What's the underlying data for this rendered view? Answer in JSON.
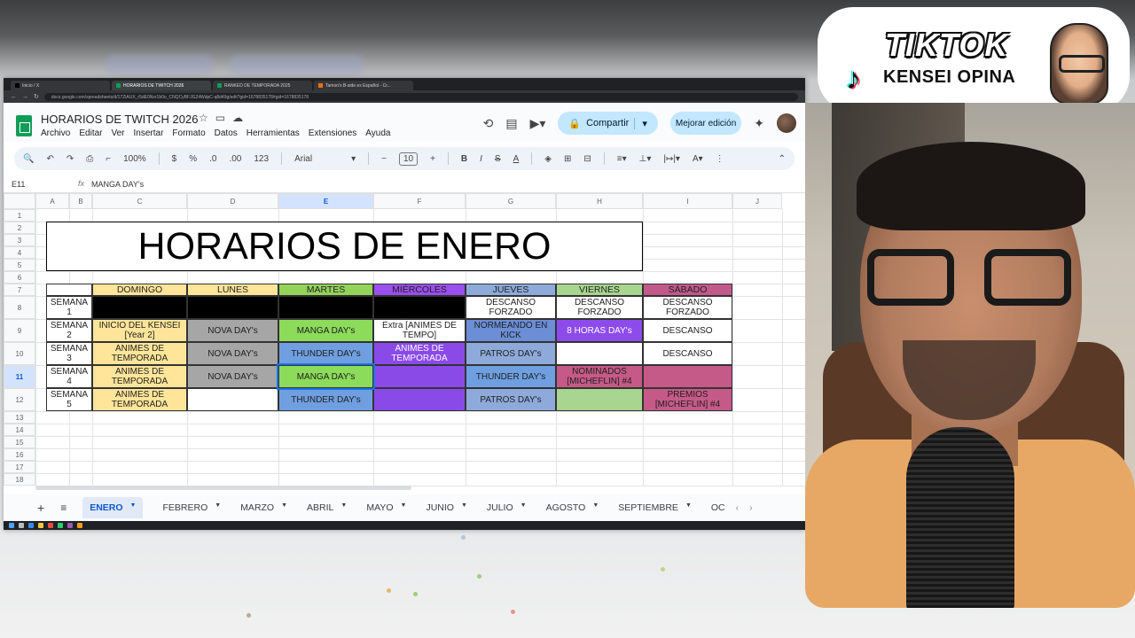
{
  "browser": {
    "tabs": [
      "Inicio / X",
      "HORARIOS DE TWITCH 2026",
      "RANKED DE TEMPORADA 2025",
      "Tamon's B-side es Español - Cr..."
    ],
    "url": "docs.google.com/spreadsheets/d/17ZiAUX_r5dE0Nxr1b0o_CNQCyBFJG24WdpC-q8d49g/edit?gid=1678835178#gid=1678835178"
  },
  "doc": {
    "title": "HORARIOS DE TWITCH 2026",
    "menu": [
      "Archivo",
      "Editar",
      "Ver",
      "Insertar",
      "Formato",
      "Datos",
      "Herramientas",
      "Extensiones",
      "Ayuda"
    ],
    "share_label": "Compartir",
    "improve_label": "Mejorar edición"
  },
  "toolbar": {
    "zoom": "100%",
    "currency": "$",
    "percent": "%",
    "dec_less": ".0",
    "dec_more": ".00",
    "number_format": "123",
    "font": "Arial",
    "font_size": "10",
    "bold": "B",
    "italic": "I",
    "strike": "S",
    "text_color": "A"
  },
  "formula_bar": {
    "cell_ref": "E11",
    "fx": "fx",
    "content": "MANGA DAY's"
  },
  "grid": {
    "columns": [
      "A",
      "B",
      "C",
      "D",
      "E",
      "F",
      "G",
      "H",
      "I",
      "J"
    ],
    "rows": [
      "1",
      "2",
      "3",
      "4",
      "5",
      "6",
      "7",
      "8",
      "9",
      "10",
      "11",
      "12",
      "13",
      "14",
      "15",
      "16",
      "17",
      "18"
    ],
    "title": "HORARIOS DE ENERO",
    "days": [
      "DOMINGO",
      "LUNES",
      "MARTES",
      "MIÉRCOLES",
      "JUEVES",
      "VIERNES",
      "SÁBADO"
    ],
    "weeks": [
      "SEMANA 1",
      "SEMANA 2",
      "SEMANA 3",
      "SEMANA 4",
      "SEMANA 5"
    ],
    "schedule": [
      [
        "",
        "",
        "",
        "",
        "DESCANSO FORZADO",
        "DESCANSO FORZADO",
        "DESCANSO FORZADO"
      ],
      [
        "INICIO DEL KENSEI [Year 2]",
        "NOVA DAY's",
        "MANGA DAY's",
        "Extra [ANIMES DE TEMPO]",
        "NORMEANDO EN KICK",
        "8 HORAS DAY's",
        "DESCANSO"
      ],
      [
        "ANIMES DE TEMPORADA",
        "NOVA DAY's",
        "THUNDER DAY's",
        "ANIMES DE TEMPORADA",
        "PATROS DAY's",
        "",
        "DESCANSO"
      ],
      [
        "ANIMES DE TEMPORADA",
        "NOVA DAY's",
        "MANGA DAY's",
        "",
        "THUNDER DAY's",
        "NOMINADOS [MICHEFLIN] #4",
        ""
      ],
      [
        "ANIMES DE TEMPORADA",
        "",
        "THUNDER DAY's",
        "",
        "PATROS DAY's",
        "",
        "PREMIOS [MICHEFLIN] #4"
      ]
    ]
  },
  "colors": {
    "domingo": "#ffe599",
    "lunes": "#ffe599",
    "martes": "#93d35a",
    "miercoles": "#9a4ff0",
    "jueves": "#8eaadb",
    "viernes": "#a8d58f",
    "sabado": "#c2598b",
    "nova": "#a6a6a6",
    "manga": "#8cdb5a",
    "thunder": "#6f9fe0",
    "purple": "#8a4ae8",
    "kick": "#6c8ed6",
    "viernes_purple": "#8d4bec",
    "nominados": "#c55a88",
    "black": "#000000"
  },
  "sheet_tabs": [
    "ENERO",
    "FEBRERO",
    "MARZO",
    "ABRIL",
    "MAYO",
    "JUNIO",
    "JULIO",
    "AGOSTO",
    "SEPTIEMBRE",
    "OC"
  ],
  "overlay": {
    "brand": "TIKTOK",
    "channel": "KENSEI OPINA"
  }
}
